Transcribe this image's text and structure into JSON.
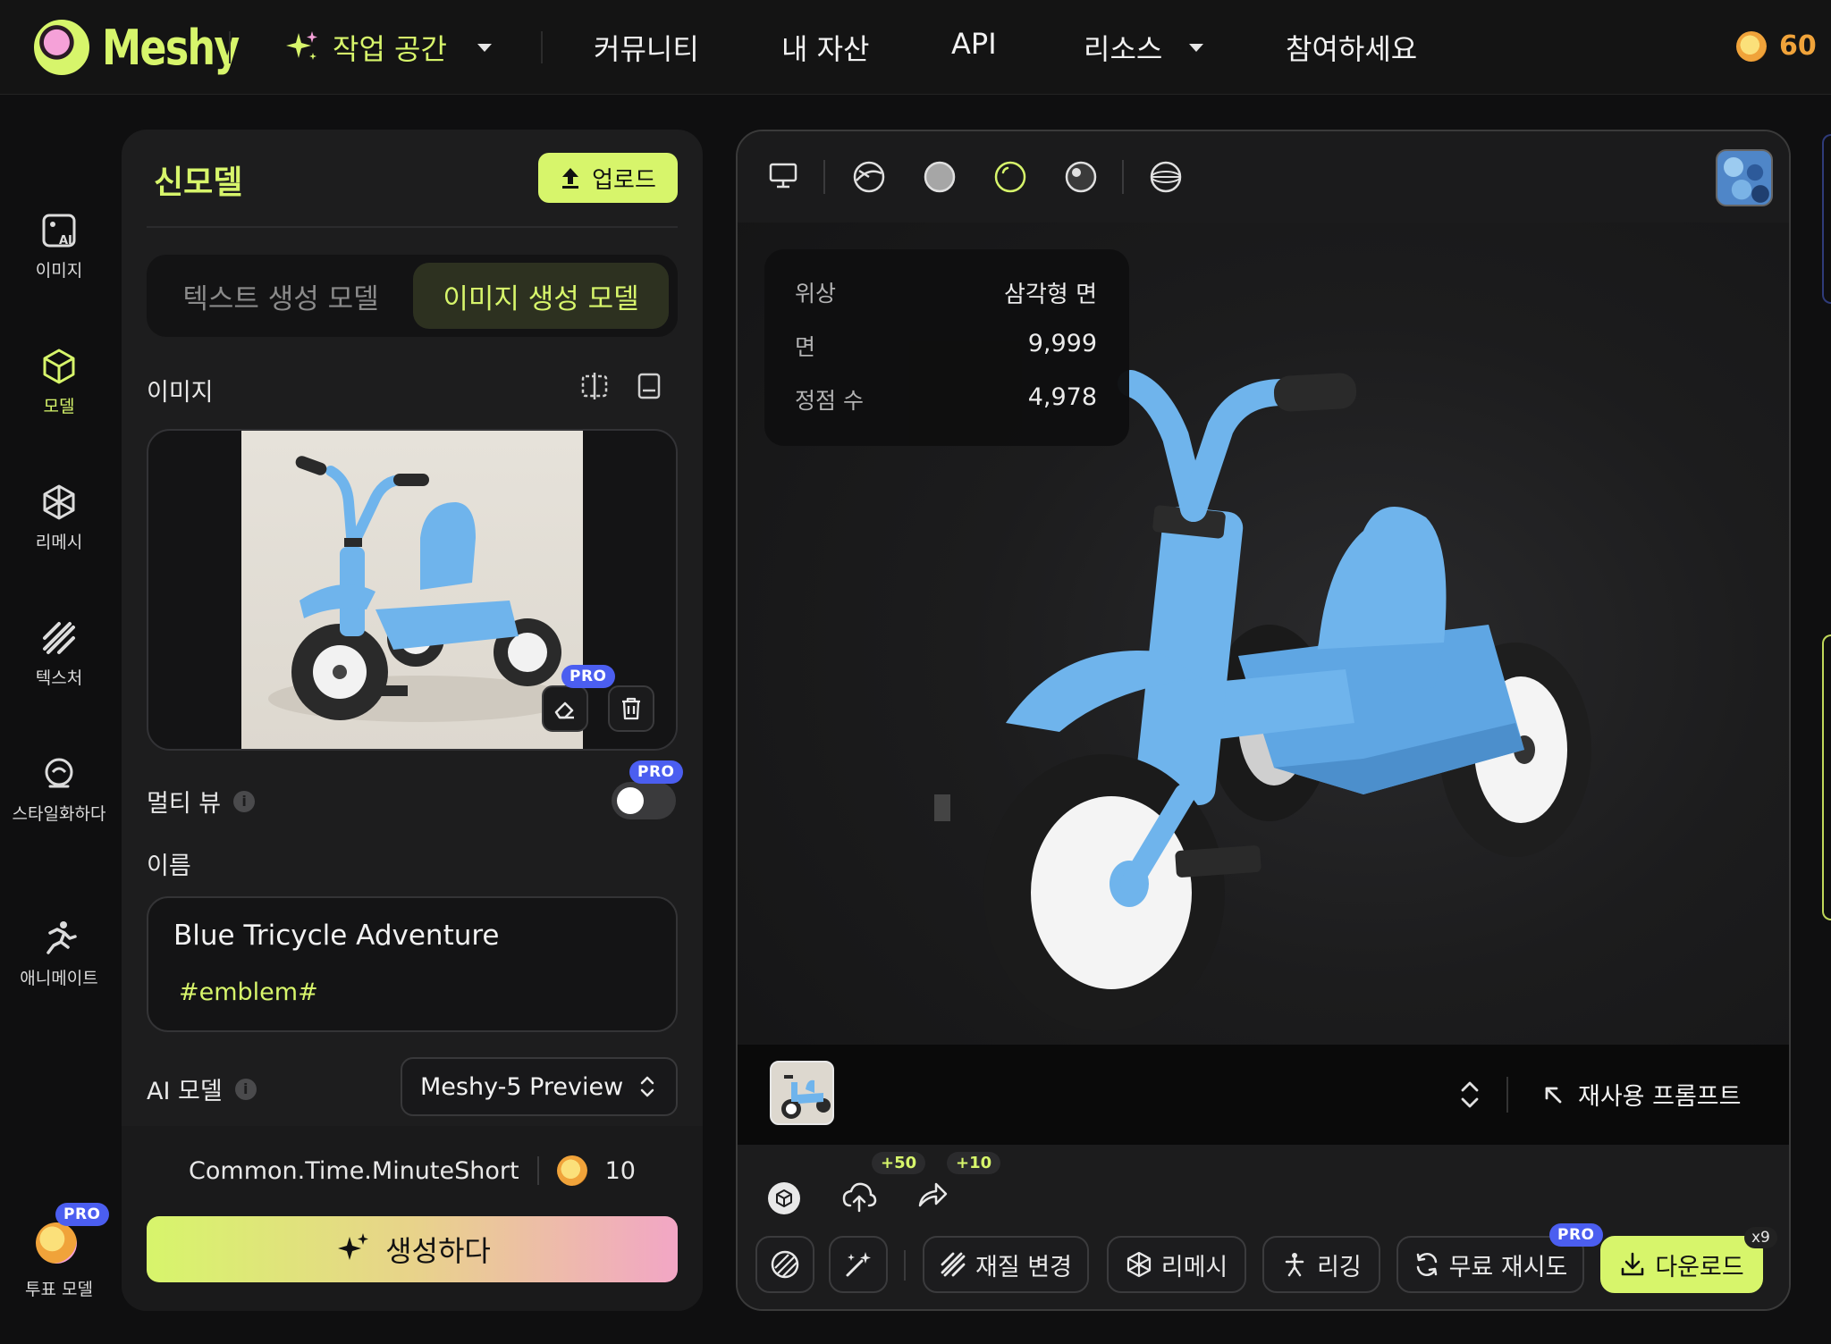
{
  "header": {
    "logo_text": "Meshy",
    "nav": {
      "workspace": "작업 공간",
      "community": "커뮤니티",
      "assets": "내 자산",
      "api": "API",
      "resources": "리소스",
      "join": "참여하세요"
    },
    "credits": "60"
  },
  "sidebar": {
    "items": [
      {
        "label": "이미지",
        "icon": "image-ai-icon"
      },
      {
        "label": "모델",
        "icon": "cube-icon"
      },
      {
        "label": "리메시",
        "icon": "remesh-icon"
      },
      {
        "label": "텍스처",
        "icon": "texture-icon"
      },
      {
        "label": "스타일화하다",
        "icon": "stylize-icon"
      },
      {
        "label": "애니메이트",
        "icon": "running-icon"
      },
      {
        "label": "투표 모델",
        "icon": "vote-icon"
      }
    ],
    "active": "모델",
    "pro_badge": "PRO"
  },
  "panel": {
    "title": "신모델",
    "upload_label": "업로드",
    "tabs": [
      "텍스트 생성 모델",
      "이미지 생성 모델"
    ],
    "active_tab": "이미지 생성 모델",
    "image_section_label": "이미지",
    "pro_badge": "PRO",
    "multiview_label": "멀티 뷰",
    "multiview_enabled": false,
    "name_label": "이름",
    "name_value": "Blue Tricycle Adventure",
    "tag_value": "#emblem#",
    "ai_model_label": "AI 모델",
    "ai_model_value": "Meshy-5 Preview",
    "time_estimate": "Common.Time.MinuteShort",
    "cost": "10",
    "generate_label": "생성하다"
  },
  "viewer": {
    "stats": [
      {
        "label": "위상",
        "value": "삼각형 면"
      },
      {
        "label": "면",
        "value": "9,999"
      },
      {
        "label": "정점 수",
        "value": "4,978"
      }
    ],
    "reuse_prompt_label": "재사용 프롬프트",
    "bonus_upload": "+50",
    "bonus_share": "+10",
    "actions": {
      "retexture": "재질 변경",
      "remesh": "리메시",
      "rigging": "리깅",
      "retry": "무료 재시도",
      "download": "다운로드"
    },
    "retry_pro_badge": "PRO",
    "download_badge": "x9"
  },
  "colors": {
    "accent": "#d7f56b",
    "bg": "#0f0f10",
    "panel": "#1d1d1e",
    "pro": "#4b5ef0",
    "tricycle_blue": "#6fb4ec"
  }
}
